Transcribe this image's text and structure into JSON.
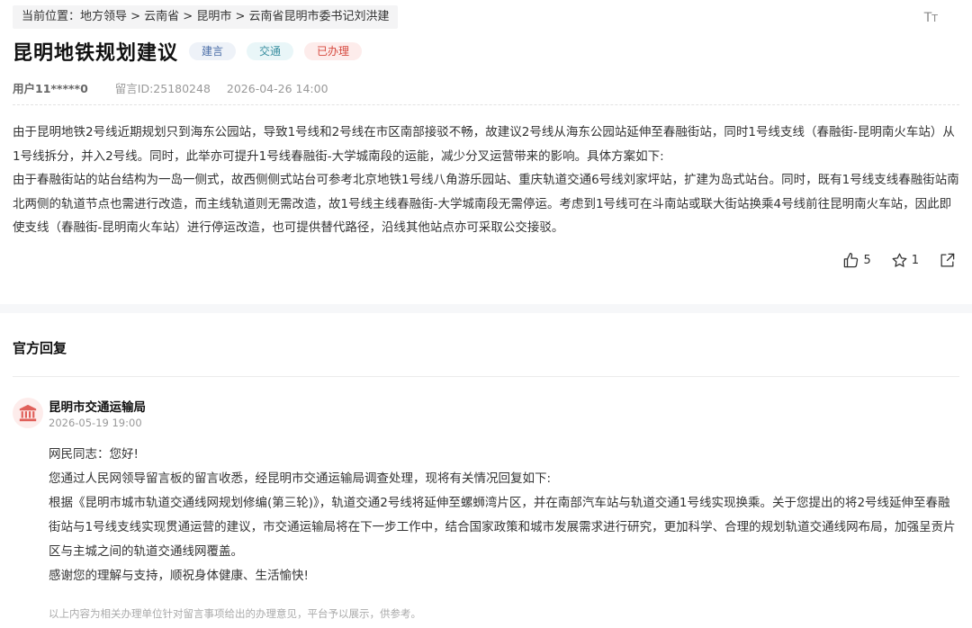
{
  "breadcrumb": "当前位置：地方领导 > 云南省 > 昆明市 > 云南省昆明市委书记刘洪建",
  "font_size_button": {
    "big": "T",
    "small": "T"
  },
  "post": {
    "title": "昆明地铁规划建议",
    "tags": [
      {
        "label": "建言",
        "color": "#4a6da7"
      },
      {
        "label": "交通",
        "color": "#3a8fa0"
      },
      {
        "label": "已办理",
        "color": "#d64a3f"
      }
    ],
    "user": "用户11*****0",
    "message_id": "留言ID:25180248",
    "datetime": "2026-04-26 14:00",
    "paragraphs": [
      "由于昆明地铁2号线近期规划只到海东公园站，导致1号线和2号线在市区南部接驳不畅，故建议2号线从海东公园站延伸至春融街站，同时1号线支线（春融街-昆明南火车站）从1号线拆分，并入2号线。同时，此举亦可提升1号线春融街-大学城南段的运能，减少分叉运营带来的影响。具体方案如下:",
      "由于春融街站的站台结构为一岛一侧式，故西侧侧式站台可参考北京地铁1号线八角游乐园站、重庆轨道交通6号线刘家坪站，扩建为岛式站台。同时，既有1号线支线春融街站南北两侧的轨道节点也需进行改造，而主线轨道则无需改造，故1号线主线春融街-大学城南段无需停运。考虑到1号线可在斗南站或联大街站换乘4号线前往昆明南火车站，因此即使支线（春融街-昆明南火车站）进行停运改造，也可提供替代路径，沿线其他站点亦可采取公交接驳。"
    ],
    "likes": "5",
    "favorites": "1"
  },
  "reply": {
    "section_title": "官方回复",
    "org": "昆明市交通运输局",
    "date": "2026-05-19 19:00",
    "paragraphs": [
      "网民同志：您好!",
      "您通过人民网领导留言板的留言收悉，经昆明市交通运输局调查处理，现将有关情况回复如下:",
      "根据《昆明市城市轨道交通线网规划修编(第三轮)》，轨道交通2号线将延伸至螺蛳湾片区，并在南部汽车站与轨道交通1号线实现换乘。关于您提出的将2号线延伸至春融街站与1号线支线实现贯通运营的建议，市交通运输局将在下一步工作中，结合国家政策和城市发展需求进行研究，更加科学、合理的规划轨道交通线网布局，加强呈贡片区与主城之间的轨道交通线网覆盖。",
      "感谢您的理解与支持，顺祝身体健康、生活愉快!"
    ],
    "disclaimer": "以上内容为相关办理单位针对留言事项给出的办理意见，平台予以展示，供参考。"
  }
}
